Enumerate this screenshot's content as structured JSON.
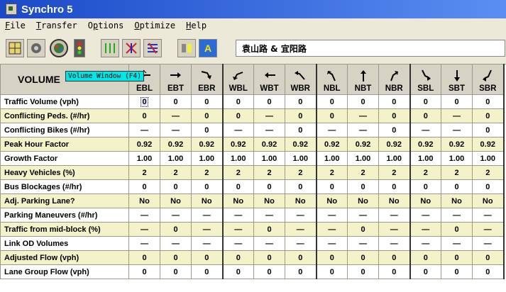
{
  "window": {
    "title": "Synchro 5"
  },
  "menu": [
    {
      "label": "File",
      "u": "F"
    },
    {
      "label": "Transfer",
      "u": "T"
    },
    {
      "label": "Options",
      "u": "p"
    },
    {
      "label": "Optimize",
      "u": "O"
    },
    {
      "label": "Help",
      "u": "H"
    }
  ],
  "toolbar": {
    "location": "袁山路 & 宜阳路",
    "tooltip": "Volume Window (F4)",
    "buttons": [
      "map-view-icon",
      "node-settings-icon",
      "volume-window-icon",
      "signal-icon",
      "lane-window-icon",
      "timing-window-icon",
      "phasing-icon",
      "report-icon",
      "analysis-icon"
    ]
  },
  "table": {
    "corner_label": "VOLUME",
    "movements": [
      "EBL",
      "EBT",
      "EBR",
      "WBL",
      "WBT",
      "WBR",
      "NBL",
      "NBT",
      "NBR",
      "SBL",
      "SBT",
      "SBR"
    ],
    "rows": [
      {
        "label": "Traffic Volume (vph)",
        "values": [
          "0",
          "0",
          "0",
          "0",
          "0",
          "0",
          "0",
          "0",
          "0",
          "0",
          "0",
          "0"
        ],
        "shade": false,
        "blue": false
      },
      {
        "label": "Conflicting Peds. (#/hr)",
        "values": [
          "0",
          "—",
          "0",
          "0",
          "—",
          "0",
          "0",
          "—",
          "0",
          "0",
          "—",
          "0"
        ],
        "shade": true,
        "blue": false
      },
      {
        "label": "Conflicting Bikes (#/hr)",
        "values": [
          "—",
          "—",
          "0",
          "—",
          "—",
          "0",
          "—",
          "—",
          "0",
          "—",
          "—",
          "0"
        ],
        "shade": false,
        "blue": false
      },
      {
        "label": "Peak Hour Factor",
        "values": [
          "0.92",
          "0.92",
          "0.92",
          "0.92",
          "0.92",
          "0.92",
          "0.92",
          "0.92",
          "0.92",
          "0.92",
          "0.92",
          "0.92"
        ],
        "shade": true,
        "blue": false
      },
      {
        "label": "Growth Factor",
        "values": [
          "1.00",
          "1.00",
          "1.00",
          "1.00",
          "1.00",
          "1.00",
          "1.00",
          "1.00",
          "1.00",
          "1.00",
          "1.00",
          "1.00"
        ],
        "shade": false,
        "blue": false
      },
      {
        "label": "Heavy Vehicles (%)",
        "values": [
          "2",
          "2",
          "2",
          "2",
          "2",
          "2",
          "2",
          "2",
          "2",
          "2",
          "2",
          "2"
        ],
        "shade": true,
        "blue": false
      },
      {
        "label": "Bus Blockages (#/hr)",
        "values": [
          "0",
          "0",
          "0",
          "0",
          "0",
          "0",
          "0",
          "0",
          "0",
          "0",
          "0",
          "0"
        ],
        "shade": false,
        "blue": false
      },
      {
        "label": "Adj. Parking Lane?",
        "values": [
          "No",
          "No",
          "No",
          "No",
          "No",
          "No",
          "No",
          "No",
          "No",
          "No",
          "No",
          "No"
        ],
        "shade": true,
        "blue": false
      },
      {
        "label": "Parking Maneuvers (#/hr)",
        "values": [
          "—",
          "—",
          "—",
          "—",
          "—",
          "—",
          "—",
          "—",
          "—",
          "—",
          "—",
          "—"
        ],
        "shade": false,
        "blue": false
      },
      {
        "label": "Traffic from mid-block (%)",
        "values": [
          "—",
          "0",
          "—",
          "—",
          "0",
          "—",
          "—",
          "0",
          "—",
          "—",
          "0",
          "—"
        ],
        "shade": true,
        "blue": false
      },
      {
        "label": "Link OD Volumes",
        "values": [
          "—",
          "—",
          "—",
          "—",
          "—",
          "—",
          "—",
          "—",
          "—",
          "—",
          "—",
          "—"
        ],
        "shade": false,
        "blue": false
      },
      {
        "label": "Adjusted Flow (vph)",
        "values": [
          "0",
          "0",
          "0",
          "0",
          "0",
          "0",
          "0",
          "0",
          "0",
          "0",
          "0",
          "0"
        ],
        "shade": true,
        "blue": true
      },
      {
        "label": "Lane Group Flow (vph)",
        "values": [
          "0",
          "0",
          "0",
          "0",
          "0",
          "0",
          "0",
          "0",
          "0",
          "0",
          "0",
          "0"
        ],
        "shade": false,
        "blue": true
      }
    ]
  }
}
